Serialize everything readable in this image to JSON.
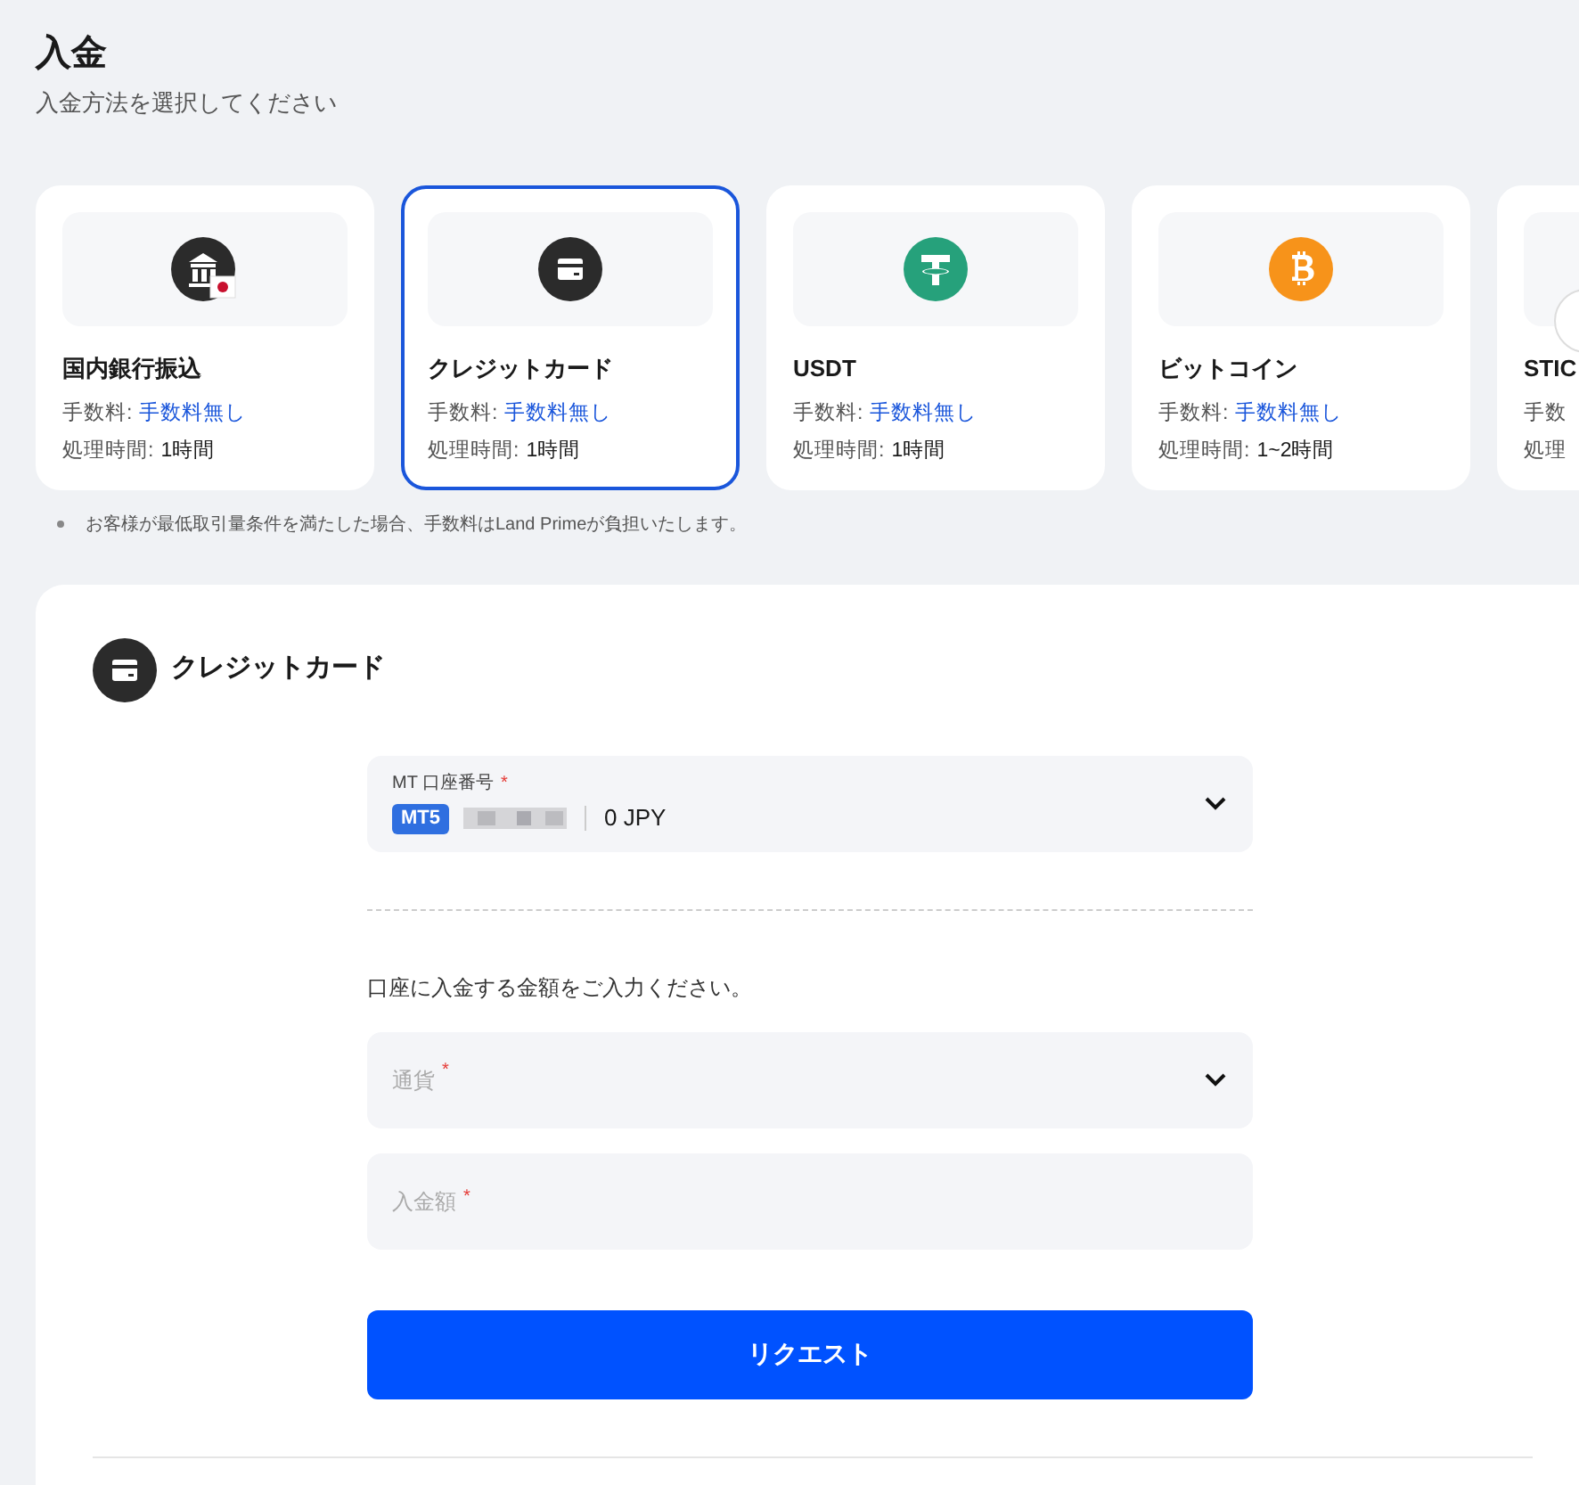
{
  "page": {
    "title": "入金",
    "subtitle": "入金方法を選択してください"
  },
  "methods": [
    {
      "kind": "bank",
      "name": "国内銀行振込",
      "fee_label": "手数料:",
      "fee_value": "手数料無し",
      "time_label": "処理時間:",
      "time_value": "1時間",
      "selected": false
    },
    {
      "kind": "card",
      "name": "クレジットカード",
      "fee_label": "手数料:",
      "fee_value": "手数料無し",
      "time_label": "処理時間:",
      "time_value": "1時間",
      "selected": true
    },
    {
      "kind": "tether",
      "name": "USDT",
      "fee_label": "手数料:",
      "fee_value": "手数料無し",
      "time_label": "処理時間:",
      "time_value": "1時間",
      "selected": false
    },
    {
      "kind": "bitcoin",
      "name": "ビットコイン",
      "fee_label": "手数料:",
      "fee_value": "手数料無し",
      "time_label": "処理時間:",
      "time_value": "1~2時間",
      "selected": false
    },
    {
      "kind": "partial",
      "name": "STIC",
      "fee_label": "手数",
      "time_label": "処理",
      "selected": false
    }
  ],
  "note": "お客様が最低取引量条件を満たした場合、手数料はLand Primeが負担いたします。",
  "form": {
    "title": "クレジットカード",
    "account": {
      "label": "MT 口座番号",
      "required_mark": "*",
      "badge": "MT5",
      "balance": "0 JPY"
    },
    "prompt": "口座に入金する金額をご入力ください。",
    "currency": {
      "placeholder": "通貨",
      "required_mark": "*"
    },
    "amount": {
      "placeholder": "入金額",
      "required_mark": "*"
    },
    "submit": "リクエスト"
  }
}
